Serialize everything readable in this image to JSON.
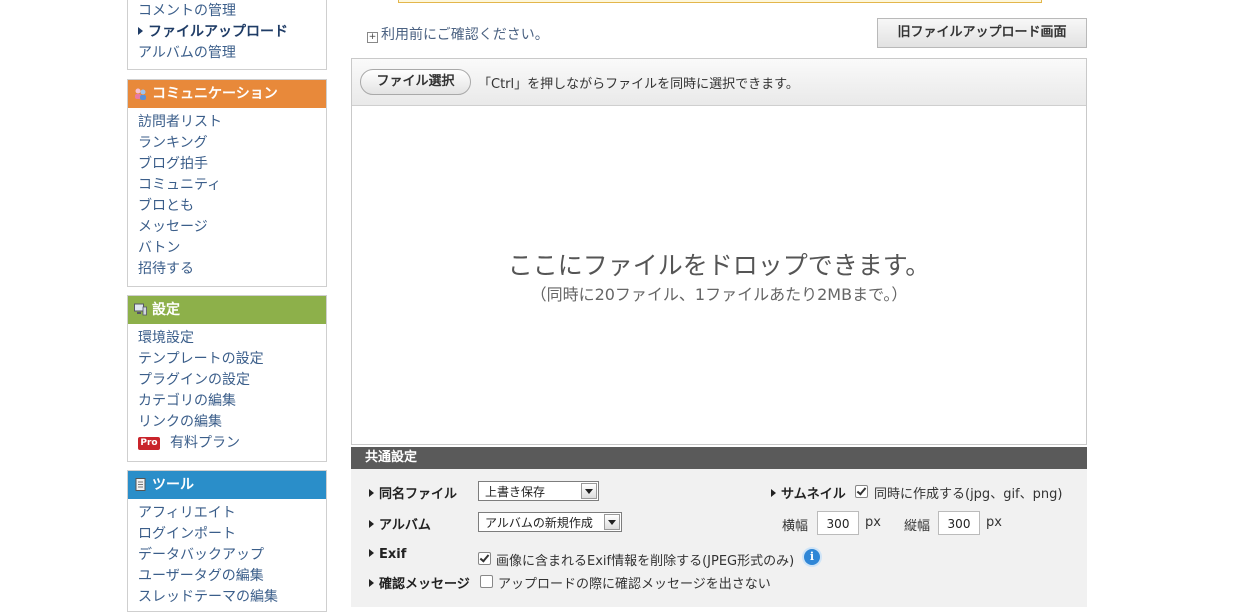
{
  "sidebar": {
    "top_links": [
      {
        "label": "コメントの管理"
      },
      {
        "label": "ファイルアップロード",
        "current": true
      },
      {
        "label": "アルバムの管理"
      }
    ],
    "communication": {
      "title": "コミュニケーション",
      "color": "#e8893a",
      "items": [
        "訪問者リスト",
        "ランキング",
        "ブログ拍手",
        "コミュニティ",
        "ブロとも",
        "メッセージ",
        "バトン",
        "招待する"
      ]
    },
    "settings": {
      "title": "設定",
      "color": "#8db04a",
      "items": [
        "環境設定",
        "テンプレートの設定",
        "プラグインの設定",
        "カテゴリの編集",
        "リンクの編集",
        "有料プラン"
      ],
      "pro_badge": "Pro"
    },
    "tools": {
      "title": "ツール",
      "color": "#2a8ec9",
      "items": [
        "アフィリエイト",
        "ログインポート",
        "データバックアップ",
        "ユーザータグの編集",
        "スレッドテーマの編集"
      ]
    }
  },
  "main": {
    "notice": "利用前にご確認ください。",
    "old_upload_button": "旧ファイルアップロード画面",
    "file_select_button": "ファイル選択",
    "ctrl_hint": "「Ctrl」を押しながらファイルを同時に選択できます。",
    "drop_main": "ここにファイルをドロップできます。",
    "drop_sub": "（同時に20ファイル、1ファイルあたり2MBまで。）"
  },
  "common_settings": {
    "title": "共通設定",
    "same_name": {
      "label": "同名ファイル",
      "value": "上書き保存"
    },
    "album": {
      "label": "アルバム",
      "value": "アルバムの新規作成"
    },
    "exif": {
      "label": "Exif",
      "checked": true,
      "text": "画像に含まれるExif情報を削除する(JPEG形式のみ)"
    },
    "confirm": {
      "label": "確認メッセージ",
      "checked": false,
      "text": "アップロードの際に確認メッセージを出さない"
    },
    "thumbnail": {
      "label": "サムネイル",
      "checked": true,
      "text": "同時に作成する(jpg、gif、png)",
      "width_label": "横幅",
      "width": "300",
      "height_label": "縦幅",
      "height": "300",
      "unit": "px"
    }
  }
}
